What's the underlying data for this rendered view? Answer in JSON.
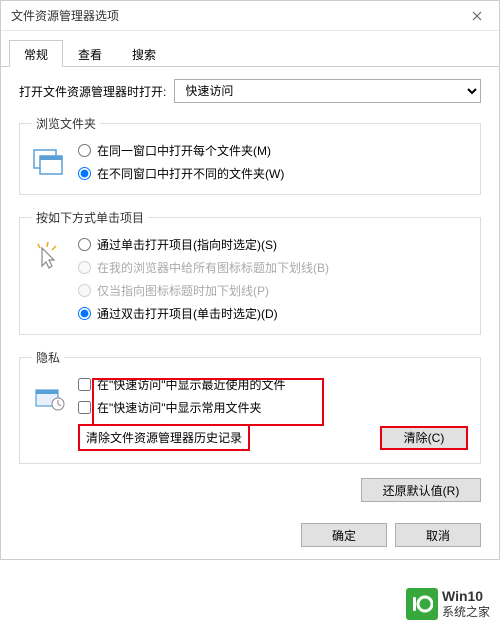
{
  "title": "文件资源管理器选项",
  "tabs": [
    "常规",
    "查看",
    "搜索"
  ],
  "active_tab": 0,
  "open_target": {
    "label": "打开文件资源管理器时打开:",
    "value": "快速访问"
  },
  "browse": {
    "legend": "浏览文件夹",
    "options": [
      {
        "label": "在同一窗口中打开每个文件夹(M)",
        "checked": false
      },
      {
        "label": "在不同窗口中打开不同的文件夹(W)",
        "checked": true
      }
    ]
  },
  "click": {
    "legend": "按如下方式单击项目",
    "options": [
      {
        "label": "通过单击打开项目(指向时选定)(S)",
        "checked": false,
        "disabled": false
      },
      {
        "label": "在我的浏览器中给所有图标标题加下划线(B)",
        "checked": false,
        "disabled": true
      },
      {
        "label": "仅当指向图标标题时加下划线(P)",
        "checked": false,
        "disabled": true
      },
      {
        "label": "通过双击打开项目(单击时选定)(D)",
        "checked": true,
        "disabled": false
      }
    ]
  },
  "privacy": {
    "legend": "隐私",
    "options": [
      {
        "label": "在\"快速访问\"中显示最近使用的文件",
        "checked": false
      },
      {
        "label": "在\"快速访问\"中显示常用文件夹",
        "checked": false
      }
    ],
    "clear_label": "清除文件资源管理器历史记录",
    "clear_btn": "清除(C)"
  },
  "restore_btn": "还原默认值(R)",
  "footer": {
    "ok": "确定",
    "cancel": "取消"
  },
  "watermark": {
    "line1": "Win10",
    "line2": "系统之家"
  }
}
